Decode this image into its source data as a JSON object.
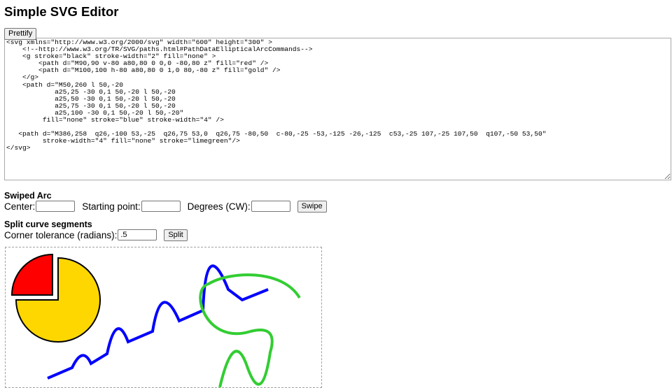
{
  "title": "Simple SVG Editor",
  "prettify_label": "Prettify",
  "editor": {
    "code": "<svg xmlns=\"http://www.w3.org/2000/svg\" width=\"600\" height=\"300\" >\n    <!--http://www.w3.org/TR/SVG/paths.html#PathDataEllipticalArcCommands-->\n    <g stroke=\"black\" stroke-width=\"2\" fill=\"none\" >\n        <path d=\"M90,90 v-80 a80,80 0 0,0 -80,80 z\" fill=\"red\" />\n        <path d=\"M100,100 h-80 a80,80 0 1,0 80,-80 z\" fill=\"gold\" />\n    </g>\n    <path d=\"M50,260 l 50,-20\n            a25,25 -30 0,1 50,-20 l 50,-20\n            a25,50 -30 0,1 50,-20 l 50,-20\n            a25,75 -30 0,1 50,-20 l 50,-20\n            a25,100 -30 0,1 50,-20 l 50,-20\"\n         fill=\"none\" stroke=\"blue\" stroke-width=\"4\" />\n\n   <path d=\"M386,258  q26,-100 53,-25  q26,75 53,0  q26,75 -80,50  c-80,-25 -53,-125 -26,-125  c53,-25 107,-25 107,50  q107,-50 53,50\"\n         stroke-width=\"4\" fill=\"none\" stroke=\"limegreen\"/>\n</svg>"
  },
  "swiped_arc": {
    "heading": "Swiped Arc",
    "center_label": "Center:",
    "center_value": "",
    "start_label": "Starting point:",
    "start_value": "",
    "degrees_label": "Degrees (CW):",
    "degrees_value": "",
    "button_label": "Swipe"
  },
  "split_curve": {
    "heading": "Split curve segments",
    "tolerance_label": "Corner tolerance (radians):",
    "tolerance_value": ".5",
    "button_label": "Split"
  },
  "preview": {
    "colors": {
      "red_wedge": "#ff0000",
      "gold_pie": "#ffd700",
      "blue_path": "#0000ff",
      "green_path": "#32cd32",
      "outline": "#000000"
    }
  }
}
